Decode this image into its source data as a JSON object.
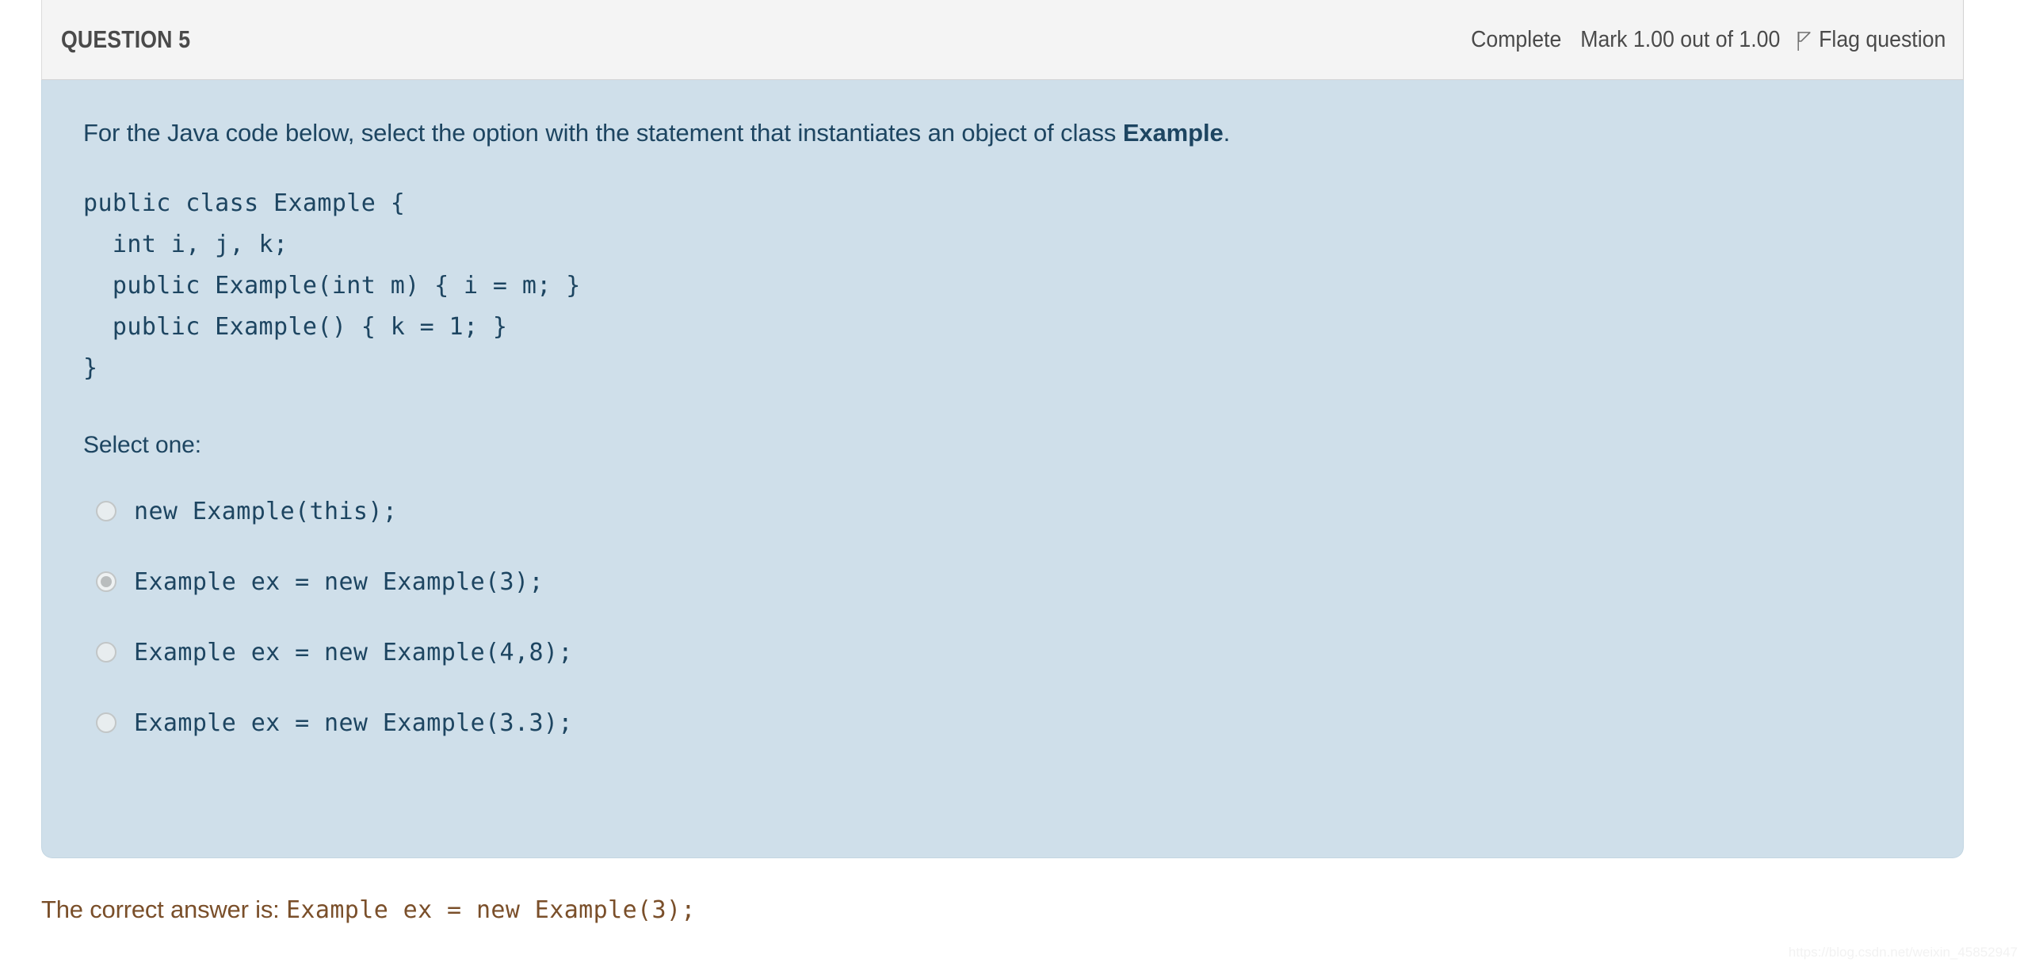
{
  "header": {
    "title": "QUESTION 5",
    "state": "Complete",
    "grade": "Mark 1.00 out of 1.00",
    "flag_icon": "flag-outline-icon",
    "flag_label": "Flag question"
  },
  "question": {
    "prompt_before": "For the Java code below, select the option with the statement that instantiates an object of class ",
    "prompt_bold": "Example",
    "prompt_after": ".",
    "code": "public class Example {\n  int i, j, k;\n  public Example(int m) { i = m; }\n  public Example() { k = 1; }\n}",
    "select_label": "Select one:"
  },
  "answers": [
    {
      "text": "new Example(this);",
      "selected": false
    },
    {
      "text": "Example ex = new Example(3);",
      "selected": true
    },
    {
      "text": "Example ex = new Example(4,8);",
      "selected": false
    },
    {
      "text": "Example ex = new Example(3.3);",
      "selected": false
    }
  ],
  "feedback": {
    "label": "The correct answer is: ",
    "code": "Example ex = new Example(3);"
  },
  "watermark": "https://blog.csdn.net/weixin_45852947",
  "colors": {
    "content_bg": "#cfdfea",
    "header_bg": "#f4f4f4",
    "text_navy": "#1d4561",
    "feedback_brown": "#7a4f2a",
    "header_text": "#4a4a4a"
  }
}
